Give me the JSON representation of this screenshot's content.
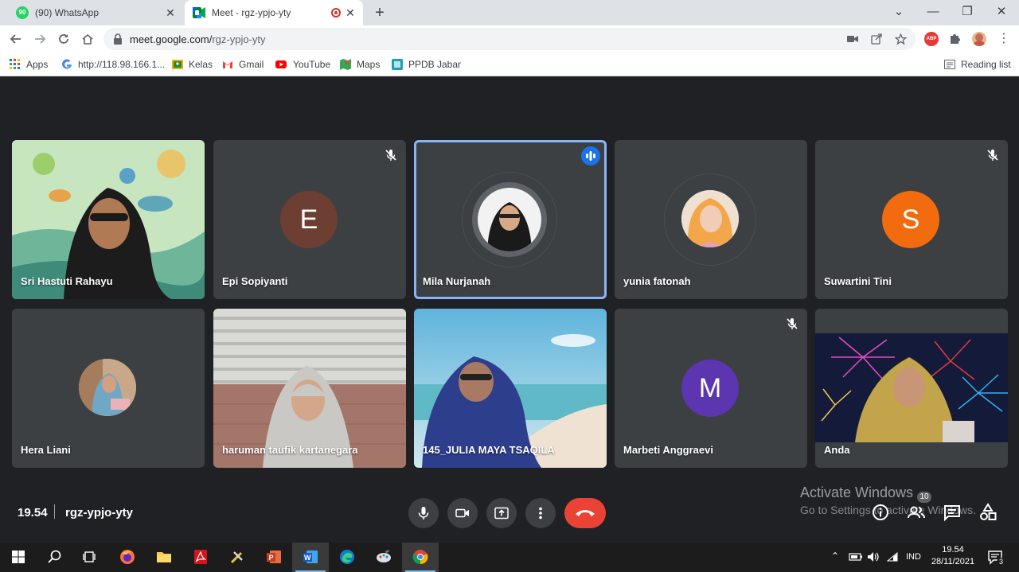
{
  "browser": {
    "tabs": [
      {
        "title": "(90) WhatsApp",
        "badge": "90",
        "active": false
      },
      {
        "title": "Meet - rgz-ypjo-yty",
        "active": true
      }
    ],
    "new_tab": "+",
    "window_controls": {
      "dropdown": "⌄",
      "minimize": "—",
      "maximize": "❐",
      "close": "✕"
    },
    "tab_close": "✕",
    "url_host": "meet.google.com/",
    "url_path": "rgz-ypjo-yty",
    "abp_label": "ABP",
    "bookmarks": [
      {
        "label": "Apps",
        "icon": "apps-grid-icon"
      },
      {
        "label": "http://118.98.166.1...",
        "icon": "google-icon"
      },
      {
        "label": "Kelas",
        "icon": "kelas-icon"
      },
      {
        "label": "Gmail",
        "icon": "gmail-icon"
      },
      {
        "label": "YouTube",
        "icon": "youtube-icon"
      },
      {
        "label": "Maps",
        "icon": "maps-icon"
      },
      {
        "label": "PPDB Jabar",
        "icon": "ppdb-icon"
      }
    ],
    "reading_list": "Reading list"
  },
  "meet": {
    "participants": [
      {
        "name": "Sri Hastuti Rahayu",
        "type": "video",
        "muted": false
      },
      {
        "name": "Epi Sopiyanti",
        "type": "letter",
        "letter": "E",
        "color": "#6d3f33",
        "muted": true
      },
      {
        "name": "Mila Nurjanah",
        "type": "photo",
        "muted": false,
        "speaking": true
      },
      {
        "name": "yunia fatonah",
        "type": "photo",
        "muted": false
      },
      {
        "name": "Suwartini Tini",
        "type": "letter",
        "letter": "S",
        "color": "#f26b0f",
        "muted": true
      },
      {
        "name": "Hera Liani",
        "type": "photo",
        "muted": false
      },
      {
        "name": "haruman taufik kartanegara",
        "type": "video",
        "muted": false
      },
      {
        "name": "145_JULIA MAYA TSAQILA",
        "type": "video",
        "muted": false
      },
      {
        "name": "Marbeti Anggraevi",
        "type": "letter",
        "letter": "M",
        "color": "#5c35b0",
        "muted": true
      },
      {
        "name": "Anda",
        "type": "video",
        "muted": false
      }
    ],
    "time": "19.54",
    "meeting_code": "rgz-ypjo-yty",
    "people_count": "10",
    "accent": "#8ab4f8",
    "hangup_color": "#ea4335"
  },
  "watermark": {
    "line1": "Activate Windows",
    "line2": "Go to Settings to activate Windows."
  },
  "taskbar": {
    "language": "IND",
    "time": "19.54",
    "date": "28/11/2021",
    "notifications": "3"
  }
}
